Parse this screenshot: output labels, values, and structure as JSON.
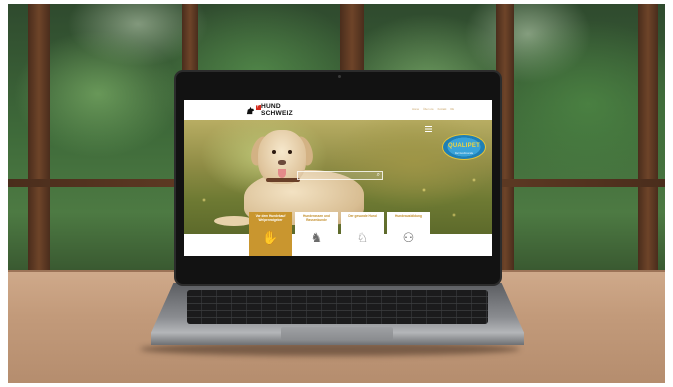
{
  "website": {
    "logo": {
      "line1": "HUND",
      "line2": "SCHWEIZ"
    },
    "nav": [
      "Home",
      "Über uns",
      "Kontakt",
      "DE"
    ],
    "search": {
      "icon": "search-icon"
    },
    "badge": {
      "title": "QUALIPET",
      "subtitle": "Der Gut-Freunde"
    },
    "cards": [
      {
        "title": "Vor dem Hundekauf Welpenratgeber",
        "icon": "puppy-icon",
        "active": true
      },
      {
        "title": "Hunderassen und Rassenkunde",
        "icon": "dog-icon",
        "active": false
      },
      {
        "title": "Der gesunde Hund",
        "icon": "health-icon",
        "active": false
      },
      {
        "title": "Hundeausbildung",
        "icon": "training-icon",
        "active": false
      }
    ]
  },
  "colors": {
    "accent": "#c9962f",
    "brand_red": "#d52b1e"
  }
}
